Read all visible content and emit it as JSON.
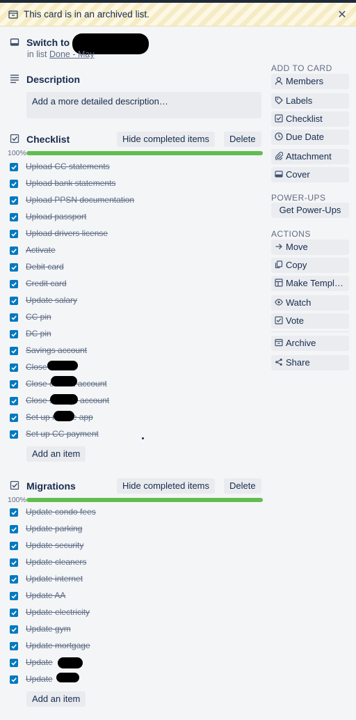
{
  "banner": {
    "text": "This card is in an archived list.",
    "close_icon": "close-icon"
  },
  "card": {
    "title": "Switch to",
    "in_list_prefix": "in list",
    "list_name": "Done - May"
  },
  "description": {
    "heading": "Description",
    "placeholder": "Add a more detailed description…"
  },
  "checklists": [
    {
      "title": "Checklist",
      "hide_label": "Hide completed items",
      "delete_label": "Delete",
      "progress_label": "100%",
      "progress": 1.0,
      "items": [
        "Upload CC statements",
        "Upload bank statements",
        "Upload PPSN documentation",
        "Upload passport",
        "Upload drivers license",
        "Activate",
        "Debit card",
        "Credit card",
        "Update salary",
        "CC pin",
        "DC pin",
        "Savings account",
        "Close CC",
        "Close current account",
        "Close savings account",
        "Set up mobile app",
        "Set up CC payment"
      ],
      "add_label": "Add an item"
    },
    {
      "title": "Migrations",
      "hide_label": "Hide completed items",
      "delete_label": "Delete",
      "progress_label": "100%",
      "progress": 1.0,
      "items": [
        "Update condo fees",
        "Update parking",
        "Update security",
        "Update cleaners",
        "Update internet",
        "Update AA",
        "Update electricity",
        "Update gym",
        "Update mortgage",
        "Update",
        "Update"
      ],
      "add_label": "Add an item"
    }
  ],
  "sidebar": {
    "add_to_card": {
      "heading": "ADD TO CARD",
      "items": [
        {
          "label": "Members",
          "icon": "person-icon"
        },
        {
          "label": "Labels",
          "icon": "tag-icon"
        },
        {
          "label": "Checklist",
          "icon": "checkbox-icon"
        },
        {
          "label": "Due Date",
          "icon": "clock-icon"
        },
        {
          "label": "Attachment",
          "icon": "paperclip-icon"
        },
        {
          "label": "Cover",
          "icon": "cover-icon"
        }
      ]
    },
    "power_ups": {
      "heading": "POWER-UPS",
      "button": "Get Power-Ups"
    },
    "actions": {
      "heading": "ACTIONS",
      "items": [
        {
          "label": "Move",
          "icon": "arrow-right-icon"
        },
        {
          "label": "Copy",
          "icon": "copy-icon"
        },
        {
          "label": "Make Templ…",
          "icon": "template-icon"
        },
        {
          "label": "Watch",
          "icon": "eye-icon"
        },
        {
          "label": "Vote",
          "icon": "checkbox-icon"
        },
        {
          "label": "Archive",
          "icon": "archive-icon"
        },
        {
          "label": "Share",
          "icon": "share-icon"
        }
      ]
    }
  },
  "colors": {
    "progress": "#61bd4f",
    "checkbox": "#0079bf",
    "banner": "#fdf8e4"
  }
}
